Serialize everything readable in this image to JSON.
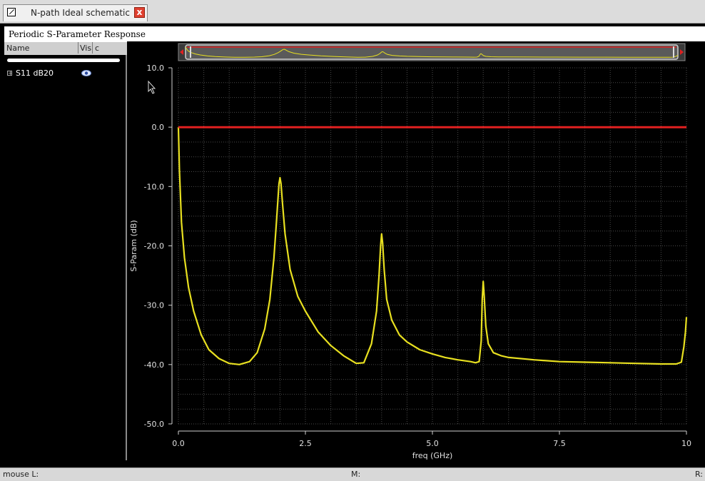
{
  "window": {
    "tab_title": "N-path Ideal schematic",
    "tab_close": "x"
  },
  "plot": {
    "panel_title": "Periodic S-Parameter Response"
  },
  "legend": {
    "columns": [
      "Name",
      "Vis",
      "c"
    ],
    "traces": [
      {
        "label": "S11 dB20",
        "visible": true,
        "color": "#e8e020"
      }
    ]
  },
  "status_bar": {
    "mouse_l": "mouse L:",
    "mouse_m": "M:",
    "mouse_r": "R:"
  },
  "colors": {
    "trace": "#e8e020",
    "reference_line": "#e02020",
    "grid": "#4a4a4a",
    "background": "#000000"
  },
  "chart_data": {
    "type": "line",
    "title": "Periodic S-Parameter Response",
    "xlabel": "freq (GHz)",
    "ylabel": "S-Param (dB)",
    "xlim": [
      0,
      10
    ],
    "ylim": [
      -50,
      10
    ],
    "xticks": [
      0,
      2.5,
      5,
      7.5,
      10
    ],
    "xtick_labels": [
      "0.0",
      "2.5",
      "5.0",
      "7.5",
      "10"
    ],
    "yticks": [
      10,
      0,
      -10,
      -20,
      -30,
      -40,
      -50
    ],
    "ytick_labels": [
      "10.0",
      "0.0",
      "-10.0",
      "-20.0",
      "-30.0",
      "-40.0",
      "-50.0"
    ],
    "grid": true,
    "series": [
      {
        "name": "S11 dB20",
        "color": "#e8e020",
        "x": [
          0,
          0.02,
          0.06,
          0.12,
          0.2,
          0.3,
          0.45,
          0.6,
          0.8,
          1.0,
          1.2,
          1.4,
          1.55,
          1.7,
          1.8,
          1.88,
          1.93,
          1.96,
          1.98,
          2.0,
          2.02,
          2.05,
          2.1,
          2.2,
          2.35,
          2.5,
          2.75,
          3.0,
          3.25,
          3.5,
          3.65,
          3.8,
          3.9,
          3.95,
          3.98,
          4.0,
          4.02,
          4.05,
          4.1,
          4.2,
          4.35,
          4.5,
          4.75,
          5.0,
          5.25,
          5.5,
          5.75,
          5.85,
          5.92,
          5.96,
          5.98,
          6.0,
          6.02,
          6.05,
          6.1,
          6.2,
          6.35,
          6.5,
          7.0,
          7.5,
          8.0,
          8.5,
          9.0,
          9.5,
          9.8,
          9.9,
          9.95,
          9.98,
          10.0
        ],
        "y": [
          0,
          -7,
          -16,
          -22,
          -27,
          -31,
          -35,
          -37.5,
          -39,
          -39.8,
          -40,
          -39.5,
          -38,
          -34,
          -29,
          -22,
          -16,
          -12,
          -9.5,
          -8.5,
          -9.5,
          -13,
          -18,
          -24,
          -28.5,
          -31,
          -34.5,
          -36.8,
          -38.5,
          -39.8,
          -39.7,
          -36.5,
          -31,
          -25,
          -20,
          -18,
          -19.5,
          -24,
          -29,
          -32.5,
          -35,
          -36.2,
          -37.5,
          -38.2,
          -38.8,
          -39.2,
          -39.5,
          -39.7,
          -39.5,
          -36,
          -29,
          -26,
          -28.5,
          -33.5,
          -36.5,
          -38,
          -38.5,
          -38.8,
          -39.2,
          -39.5,
          -39.6,
          -39.7,
          -39.8,
          -39.9,
          -39.9,
          -39.6,
          -37,
          -34.5,
          -32
        ]
      },
      {
        "name": "",
        "color": "#e02020",
        "x": [
          0,
          10
        ],
        "y": [
          0,
          0
        ]
      }
    ]
  }
}
